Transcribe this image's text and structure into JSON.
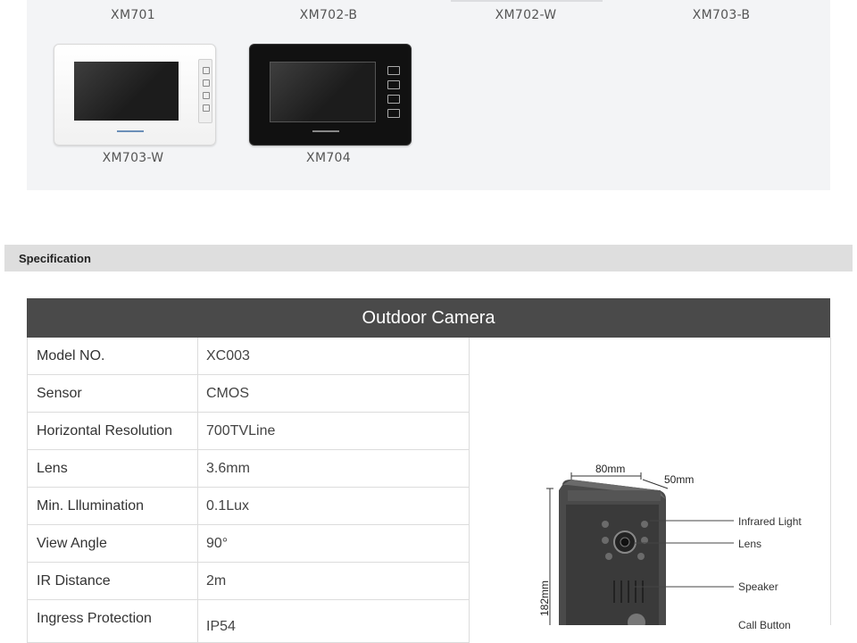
{
  "gallery": {
    "models": [
      "XM701",
      "XM702-B",
      "XM702-W",
      "XM703-B",
      "XM703-W",
      "XM704"
    ]
  },
  "section": {
    "title": "Specification"
  },
  "table": {
    "header": "Outdoor Camera",
    "rows": [
      {
        "label": "Model NO.",
        "value": "XC003"
      },
      {
        "label": "Sensor",
        "value": "CMOS"
      },
      {
        "label": "Horizontal Resolution",
        "value": "700TVLine"
      },
      {
        "label": "Lens",
        "value": "3.6mm"
      },
      {
        "label": "Min. Lllumination",
        "value": "0.1Lux"
      },
      {
        "label": "View Angle",
        "value": "90°"
      },
      {
        "label": "IR Distance",
        "value": "2m"
      },
      {
        "label": "Ingress Protection",
        "value": "IP54"
      }
    ]
  },
  "diagram": {
    "width": "80mm",
    "depth": "50mm",
    "height": "182mm",
    "callouts": [
      "Infrared Light",
      "Lens",
      "Speaker",
      "Call Button"
    ]
  },
  "colors": {
    "header_bg": "#4a4a4a",
    "section_bg": "#dedede",
    "gallery_bg": "#f3f4f6"
  }
}
